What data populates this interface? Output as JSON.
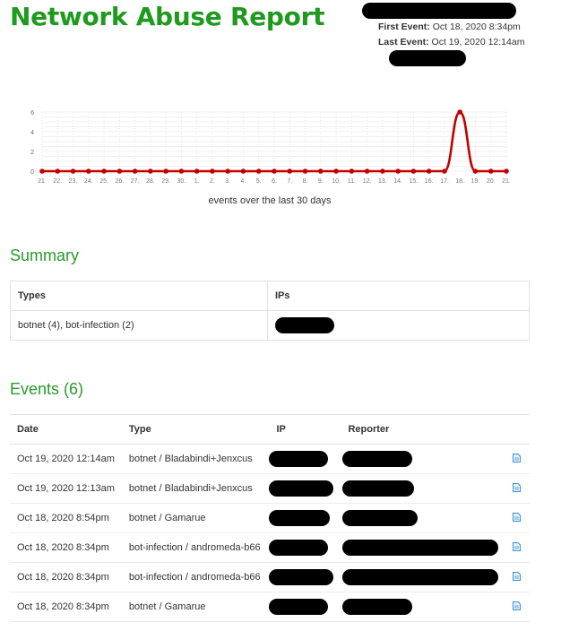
{
  "header": {
    "title": "Network Abuse Report",
    "first_event_label": "First Event:",
    "first_event_value": "Oct 18, 2020 8:34pm",
    "last_event_label": "Last Event:",
    "last_event_value": "Oct 19, 2020 12:14am"
  },
  "chart_data": {
    "type": "line",
    "categories": [
      "21.",
      "22.",
      "23.",
      "24.",
      "25.",
      "26.",
      "27.",
      "28.",
      "29.",
      "30.",
      "1.",
      "2.",
      "3.",
      "4.",
      "5.",
      "6.",
      "7.",
      "8.",
      "9.",
      "10.",
      "11.",
      "12.",
      "13.",
      "14.",
      "15.",
      "16.",
      "17.",
      "18.",
      "19.",
      "20.",
      "21."
    ],
    "values": [
      0,
      0,
      0,
      0,
      0,
      0,
      0,
      0,
      0,
      0,
      0,
      0,
      0,
      0,
      0,
      0,
      0,
      0,
      0,
      0,
      0,
      0,
      0,
      0,
      0,
      0,
      0,
      6,
      0,
      0,
      0
    ],
    "yticks": [
      "0",
      "2",
      "4",
      "6"
    ],
    "ylim": [
      0,
      6
    ],
    "grid": true,
    "line_color": "#c00000",
    "caption": "events over the last 30 days"
  },
  "summary": {
    "title": "Summary",
    "headers": [
      "Types",
      "IPs"
    ],
    "types_value": "botnet (4), bot-infection (2)"
  },
  "events": {
    "title": "Events (6)",
    "headers": [
      "Date",
      "Type",
      "IP",
      "Reporter"
    ],
    "rows": [
      {
        "date": "Oct 19, 2020 12:14am",
        "type": "botnet / Bladabindi+Jenxcus"
      },
      {
        "date": "Oct 19, 2020 12:13am",
        "type": "botnet / Bladabindi+Jenxcus"
      },
      {
        "date": "Oct 18, 2020 8:54pm",
        "type": "botnet / Gamarue"
      },
      {
        "date": "Oct 18, 2020 8:34pm",
        "type": "bot-infection / andromeda-b66"
      },
      {
        "date": "Oct 18, 2020 8:34pm",
        "type": "bot-infection / andromeda-b66"
      },
      {
        "date": "Oct 18, 2020 8:34pm",
        "type": "botnet / Gamarue"
      }
    ]
  },
  "colors": {
    "accent": "#1e9a1e",
    "section": "#2a9a2a",
    "chart_line": "#c00000",
    "icon": "#3b8fd6"
  }
}
